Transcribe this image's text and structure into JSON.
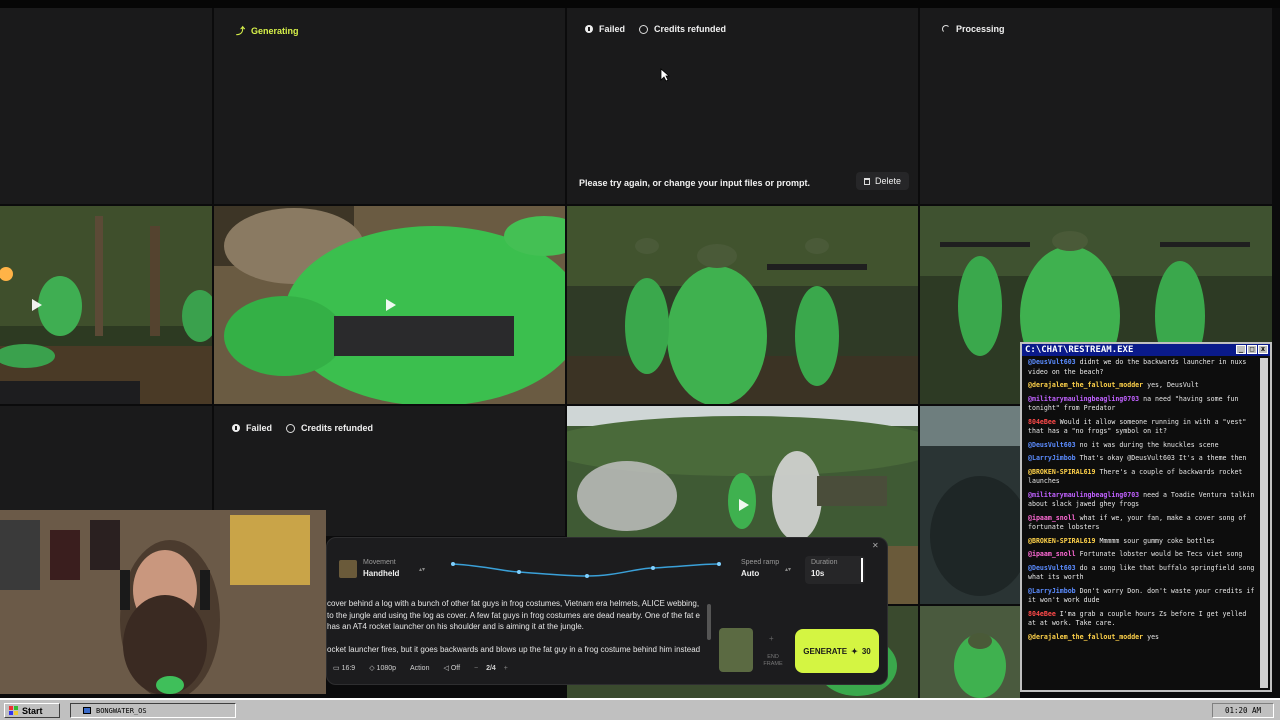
{
  "tiles": {
    "generating_label": "Generating",
    "failed_label": "Failed",
    "credits_refunded_label": "Credits refunded",
    "processing_label": "Processing",
    "failed_message": "Please try again, or change your input files or prompt.",
    "delete_label": "Delete"
  },
  "controls": {
    "movement_label": "Movement",
    "movement_value": "Handheld",
    "speed_ramp_label": "Speed ramp",
    "speed_ramp_value": "Auto",
    "duration_label": "Duration",
    "duration_value": "10s",
    "prompt_text": "cover behind a log with a bunch of other fat guys in frog costumes, Vietnam era helmets, ALICE webbing, to the jungle and using the log as cover. A few fat guys in frog costumes are dead nearby. One of the fat e has an AT4 rocket launcher on his shoulder and is aiming it at the jungle.\n\nocket launcher fires, but it goes backwards and blows up the fat guy in a frog costume behind him instead",
    "aspect_ratio": "16:9",
    "resolution": "1080p",
    "mode": "Action",
    "audio": "Off",
    "count": "2/4",
    "end_frame_label": "END FRAME",
    "generate_label": "GENERATE",
    "generate_cost": "30"
  },
  "chat": {
    "title": "C:\\CHAT\\RESTREAM.EXE",
    "messages": [
      {
        "user": "@DeusVult603",
        "color": "#5b8cff",
        "text": "didnt we do the backwards launcher in nuxs video on the beach?"
      },
      {
        "user": "@derajalem_the_fallout_modder",
        "color": "#ffd24a",
        "text": "yes, DeusVult"
      },
      {
        "user": "@militarymaulingbeagling0703",
        "color": "#c061ff",
        "text": "na need \"having some fun tonight\" from Predator"
      },
      {
        "user": "804eBee",
        "color": "#ff4a4a",
        "text": "Would it allow someone running in with a \"vest\" that has a \"no frogs\" symbol on it?"
      },
      {
        "user": "@DeusVult603",
        "color": "#5b8cff",
        "text": "no it was during the knuckles scene"
      },
      {
        "user": "@LarryJimbob",
        "color": "#5b8cff",
        "text": "That's okay @DeusVult603 It's a theme then"
      },
      {
        "user": "@BROKEN-SPIRAL619",
        "color": "#ffd24a",
        "text": "There's a couple of backwards rocket launches"
      },
      {
        "user": "@militarymaulingbeagling0703",
        "color": "#c061ff",
        "text": "need a Toadie Ventura talkin about slack jawed ghey frogs"
      },
      {
        "user": "@ipaam_snoll",
        "color": "#ff6ad5",
        "text": "what if we, your fan, make a cover song of fortunate lobsters"
      },
      {
        "user": "@BROKEN-SPIRAL619",
        "color": "#ffd24a",
        "text": "Mmmmm sour gummy coke bottles"
      },
      {
        "user": "@ipaam_snoll",
        "color": "#ff6ad5",
        "text": "Fortunate lobster would be Tecs viet song"
      },
      {
        "user": "@DeusVult603",
        "color": "#5b8cff",
        "text": "do a song like that buffalo springfield song what its worth"
      },
      {
        "user": "@LarryJimbob",
        "color": "#5b8cff",
        "text": "Don't worry Don. don't waste your credits if it won't work dude"
      },
      {
        "user": "804eBee",
        "color": "#ff4a4a",
        "text": "I'ma grab a couple hours Zs before I get yelled at at work. Take care."
      },
      {
        "user": "@derajalem_the_fallout_modder",
        "color": "#ffd24a",
        "text": "yes"
      }
    ]
  },
  "taskbar": {
    "start_label": "Start",
    "task_label": "BONGWATER_OS",
    "clock": "01:20 AM"
  },
  "colors": {
    "accent": "#d4f542",
    "frog_green": "#3fbf5a",
    "chat_titlebar": "#0a1a8a"
  }
}
